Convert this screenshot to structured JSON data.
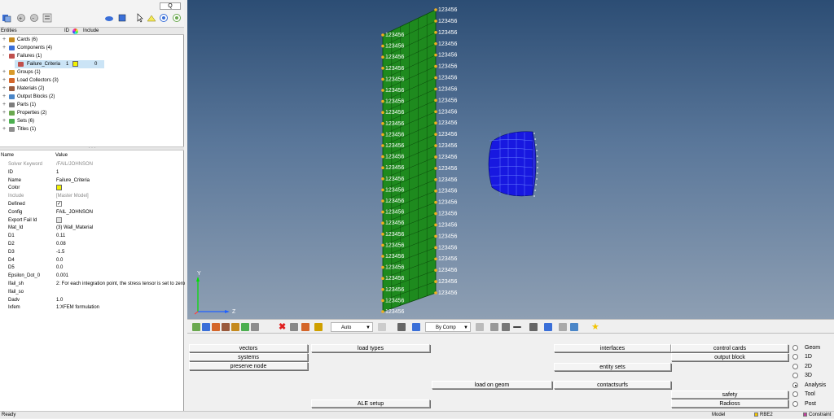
{
  "search": {
    "placeholder": "Q"
  },
  "entities_header": {
    "name_label": "Entities",
    "id_label": "ID",
    "include_label": "Include"
  },
  "tree": [
    {
      "label": "Cards (6)",
      "icon_color": "#c58a1e",
      "icon": "cards-icon"
    },
    {
      "label": "Components (4)",
      "icon_color": "#3a6fd8",
      "icon": "components-icon"
    },
    {
      "label": "Failures (1)",
      "icon_color": "#c0504d",
      "icon": "failures-icon"
    },
    {
      "label": "Groups (1)",
      "icon_color": "#d99a2b",
      "icon": "groups-icon"
    },
    {
      "label": "Load Collectors (3)",
      "icon_color": "#d4662a",
      "icon": "load-collectors-icon"
    },
    {
      "label": "Materials (2)",
      "icon_color": "#9a5a3c",
      "icon": "materials-icon"
    },
    {
      "label": "Output Blocks (2)",
      "icon_color": "#4a86c8",
      "icon": "output-blocks-icon"
    },
    {
      "label": "Parts (1)",
      "icon_color": "#7d7d7d",
      "icon": "parts-icon"
    },
    {
      "label": "Properties (2)",
      "icon_color": "#6aa84f",
      "icon": "properties-icon"
    },
    {
      "label": "Sets (6)",
      "icon_color": "#4caf50",
      "icon": "sets-icon"
    },
    {
      "label": "Titles (1)",
      "icon_color": "#8d8d8d",
      "icon": "titles-icon"
    }
  ],
  "failure_child": {
    "label": "Failure_Criteria",
    "id": "1",
    "include": "0",
    "color": "#f2f200"
  },
  "props_header": {
    "name": "Name",
    "value": "Value"
  },
  "props": [
    {
      "name": "Solver Keyword",
      "value": "/FAIL/JOHNSON",
      "dim": true
    },
    {
      "name": "ID",
      "value": "1"
    },
    {
      "name": "Name",
      "value": "Failure_Criteria"
    },
    {
      "name": "Color",
      "value": "",
      "kind": "swatch"
    },
    {
      "name": "Include",
      "value": "[Master Model]",
      "dim": true
    },
    {
      "name": "Defined",
      "value": "",
      "kind": "checked"
    },
    {
      "name": "Config",
      "value": "FAIL_JOHNSON"
    },
    {
      "name": "Export Fail Id",
      "value": "",
      "kind": "unchecked"
    },
    {
      "name": "Mat_Id",
      "value": "(3) Wall_Material"
    },
    {
      "name": "D1",
      "value": "0.11"
    },
    {
      "name": "D2",
      "value": "0.08"
    },
    {
      "name": "D3",
      "value": "-1.5"
    },
    {
      "name": "D4",
      "value": "0.0"
    },
    {
      "name": "D5",
      "value": "0.0"
    },
    {
      "name": "Epsilon_Dot_0",
      "value": "0.001"
    },
    {
      "name": "Ifail_sh",
      "value": "2: For each integration point, the stress tensor is set to zero"
    },
    {
      "name": "Ifail_so",
      "value": ""
    },
    {
      "name": "Dadv",
      "value": "1.0"
    },
    {
      "name": "Ixfem",
      "value": "1:XFEM formulation"
    }
  ],
  "viewport": {
    "node_label": "123456",
    "axis_labels": {
      "y": "Y",
      "z": "Z"
    },
    "colors": {
      "wall": "#1e8a1e",
      "projectile": "#1818e0",
      "constraint": "#f0b020"
    }
  },
  "bottom_toolbar": {
    "auto_label": "Auto",
    "by_comp_label": "By Comp"
  },
  "menu": {
    "col1": [
      "vectors",
      "systems",
      "preserve node"
    ],
    "col2": [
      "load types",
      "ALE setup"
    ],
    "col3": [
      "load on geom"
    ],
    "col4": [
      "interfaces",
      "entity sets",
      "contactsurfs"
    ],
    "col5": [
      "control cards",
      "output block",
      "safety",
      "Radioss"
    ],
    "radios": [
      "Geom",
      "1D",
      "2D",
      "3D",
      "Analysis",
      "Tool",
      "Post"
    ],
    "radio_selected": "Analysis"
  },
  "status": {
    "text": "Ready",
    "model_tab": "Model",
    "rbe_tab": "RBE2",
    "constraint_tab": "Constraint"
  }
}
